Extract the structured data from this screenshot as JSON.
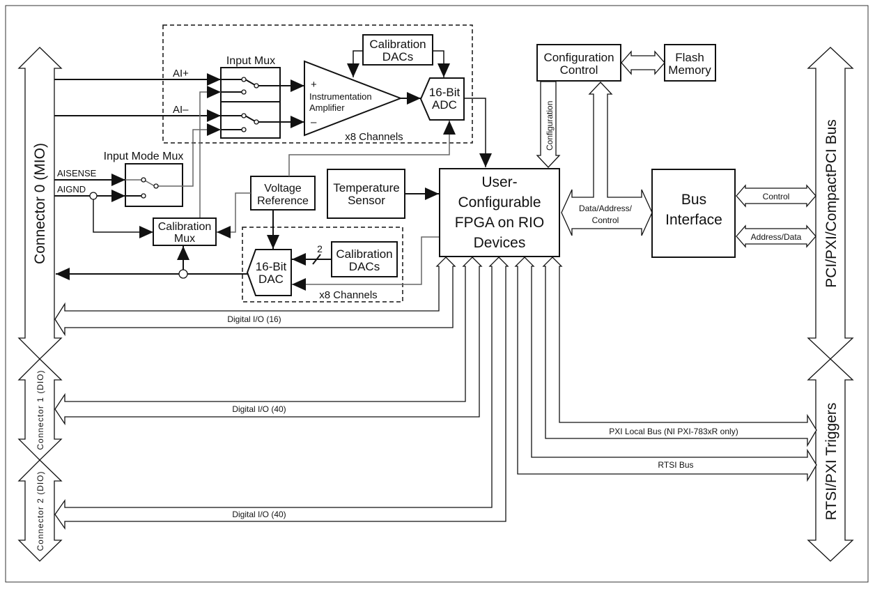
{
  "connectors": {
    "connector0": "Connector 0 (MIO)",
    "connector1": "Connector 1 (DIO)",
    "connector2": "Connector 2 (DIO)",
    "pci_bus": "PCI/PXI/CompactPCI Bus",
    "rtsi_triggers": "RTSI/PXI Triggers"
  },
  "analog_input": {
    "ai_plus": "AI+",
    "ai_minus": "AI–",
    "input_mux": "Input Mux",
    "amp_plus": "+",
    "amp_minus": "–",
    "amp_line1": "Instrumentation",
    "amp_line2": "Amplifier",
    "cal_dacs_line1": "Calibration",
    "cal_dacs_line2": "DACs",
    "adc_line1": "16-Bit",
    "adc_line2": "ADC",
    "channels": "x8 Channels"
  },
  "input_mode": {
    "title": "Input Mode Mux",
    "aisense": "AISENSE",
    "aignd": "AIGND"
  },
  "calibration_mux": {
    "line1": "Calibration",
    "line2": "Mux"
  },
  "voltage_reference": {
    "line1": "Voltage",
    "line2": "Reference"
  },
  "temperature_sensor": {
    "line1": "Temperature",
    "line2": "Sensor"
  },
  "analog_output": {
    "dac_line1": "16-Bit",
    "dac_line2": "DAC",
    "cal_dacs_line1": "Calibration",
    "cal_dacs_line2": "DACs",
    "bus_width": "2",
    "channels": "x8 Channels"
  },
  "fpga": {
    "line1": "User-",
    "line2": "Configurable",
    "line3": "FPGA on RIO",
    "line4": "Devices"
  },
  "configuration_control": {
    "line1": "Configuration",
    "line2": "Control",
    "config_label": "Configuration"
  },
  "flash_memory": {
    "line1": "Flash",
    "line2": "Memory"
  },
  "bus_interface": {
    "line1": "Bus",
    "line2": "Interface"
  },
  "buses": {
    "data_address_control_1": "Data/Address/",
    "data_address_control_2": "Control",
    "control": "Control",
    "address_data": "Address/Data",
    "dio_16": "Digital I/O (16)",
    "dio_40_conn1": "Digital I/O (40)",
    "dio_40_conn2": "Digital I/O (40)",
    "pxi_local_bus": "PXI Local Bus (NI PXI-783xR only)",
    "rtsi_bus": "RTSI Bus"
  }
}
